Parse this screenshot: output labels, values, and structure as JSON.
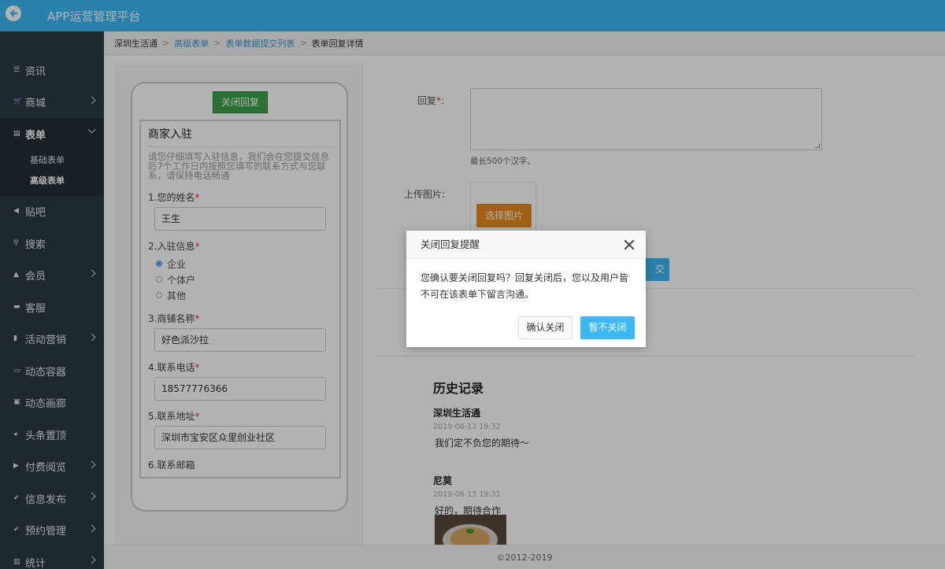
{
  "app": {
    "title": "APP运营管理平台"
  },
  "sidebar": {
    "items": [
      {
        "label": "资讯",
        "icon": "list-icon",
        "has_arrow": false
      },
      {
        "label": "商城",
        "icon": "cart-icon",
        "has_arrow": true
      },
      {
        "label": "表单",
        "icon": "form-icon",
        "has_arrow": true,
        "expanded": true,
        "children": [
          "基础表单",
          "高级表单"
        ],
        "current_child": "高级表单"
      },
      {
        "label": "贴吧",
        "icon": "megaphone-icon",
        "has_arrow": false
      },
      {
        "label": "搜索",
        "icon": "search-icon",
        "has_arrow": false
      },
      {
        "label": "会员",
        "icon": "bell-icon",
        "has_arrow": true
      },
      {
        "label": "客服",
        "icon": "chat-icon",
        "has_arrow": false
      },
      {
        "label": "活动营销",
        "icon": "bookmark-icon",
        "has_arrow": true
      },
      {
        "label": "动态容器",
        "icon": "drive-icon",
        "has_arrow": false
      },
      {
        "label": "动态画廊",
        "icon": "image-icon",
        "has_arrow": false
      },
      {
        "label": "头条置顶",
        "icon": "volume-icon",
        "has_arrow": false
      },
      {
        "label": "付费阅览",
        "icon": "play-icon",
        "has_arrow": true
      },
      {
        "label": "信息发布",
        "icon": "check-icon",
        "has_arrow": true
      },
      {
        "label": "预约管理",
        "icon": "check-icon",
        "has_arrow": true
      },
      {
        "label": "统计",
        "icon": "bar-chart-icon",
        "has_arrow": true
      }
    ]
  },
  "breadcrumb": [
    "深圳生活通",
    "高级表单",
    "表单数据提交列表",
    "表单回复详情"
  ],
  "phone": {
    "close_reply_label": "关闭回复",
    "form_title": "商家入驻",
    "form_intro": "请您仔细填写入驻信息，我们会在您提交信息后7个工作日内按照您填写的联系方式与您联系，请保持电话畅通",
    "fields": [
      {
        "label": "1.您的姓名",
        "value": "王生"
      },
      {
        "label": "3.商铺名称",
        "value": "好色派沙拉"
      },
      {
        "label": "4.联系电话",
        "value": "18577776366"
      },
      {
        "label": "5.联系地址",
        "value": "深圳市宝安区众里创业社区"
      }
    ],
    "radio_field": {
      "label": "2.入驻信息",
      "options": [
        "企业",
        "个体户",
        "其他"
      ],
      "selected": "企业"
    },
    "next_field_partial": "6.联系邮箱",
    "required_mark": "*"
  },
  "reply_form": {
    "reply_label": "回复",
    "reply_hint": "最长500个汉字。",
    "upload_label": "上传图片:",
    "pick_image_label": "选择图片",
    "submit_label_visible": "交"
  },
  "history": {
    "title": "历史记录",
    "entries": [
      {
        "author": "深圳生活通",
        "time": "2019-06-13 19:32",
        "message": "我们定不负您的期待～"
      },
      {
        "author": "尼莫",
        "time": "2019-06-13 19:31",
        "message": "好的，期待合作"
      }
    ]
  },
  "footer": {
    "copyright": "©2012-2019"
  },
  "modal": {
    "title": "关闭回复提醒",
    "body": "您确认要关闭回复吗？回复关闭后，您以及用户皆不可在该表单下留言沟通。",
    "confirm_label": "确认关闭",
    "cancel_label": "暂不关闭"
  },
  "colors": {
    "accent": "#3bb8f7",
    "sidebar": "#2a3a44",
    "green": "#3ea24b",
    "orange": "#e78a1e"
  }
}
